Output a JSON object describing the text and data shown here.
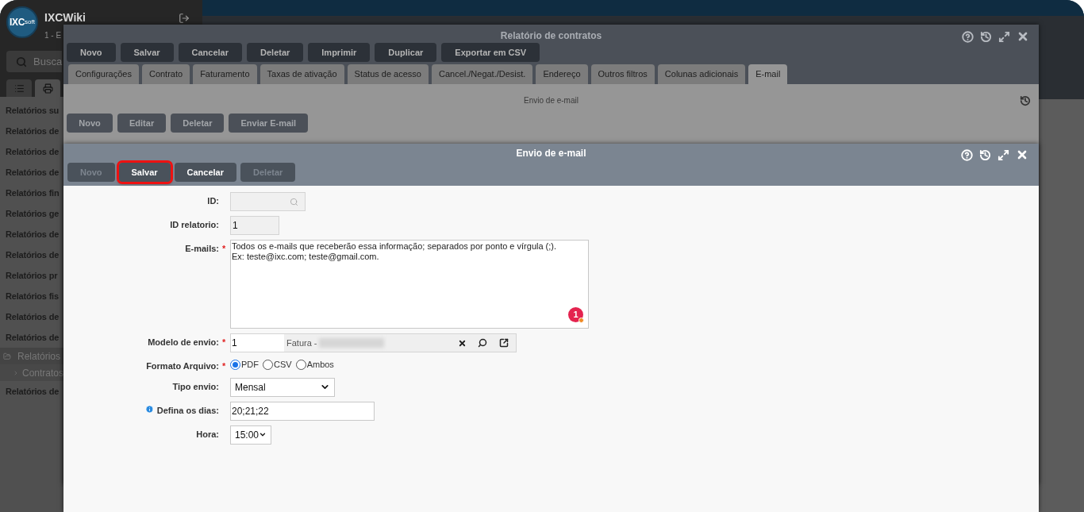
{
  "sidebar": {
    "logo": {
      "main": "IXC",
      "sub": "soft"
    },
    "app_name": "IXCWiki",
    "subtitle": "1 - E",
    "search": {
      "placeholder": "Busca"
    },
    "tabs": [
      {
        "kind": "list",
        "selected": false
      },
      {
        "kind": "print",
        "selected": true
      }
    ],
    "items": [
      {
        "label": "Relatórios su",
        "selected": false
      },
      {
        "label": "Relatórios de",
        "selected": false
      },
      {
        "label": "Relatórios de",
        "selected": false
      },
      {
        "label": "Relatórios de",
        "selected": false
      },
      {
        "label": "Relatórios fin",
        "selected": false
      },
      {
        "label": "Relatórios ge",
        "selected": false
      },
      {
        "label": "Relatórios de",
        "selected": false
      },
      {
        "label": "Relatórios de",
        "selected": false
      },
      {
        "label": "Relatórios pr",
        "selected": false
      },
      {
        "label": "Relatórios fis",
        "selected": false
      },
      {
        "label": "Relatórios de",
        "selected": false
      },
      {
        "label": "Relatórios de",
        "selected": false
      },
      {
        "label": "Relatórios",
        "kind": "folder",
        "expanded": true,
        "selected": false,
        "children": [
          {
            "label": "Contratos",
            "selected": true
          }
        ]
      },
      {
        "label": "Relatórios de",
        "selected": false
      }
    ]
  },
  "back_window": {
    "title": "Relatório de contratos",
    "toolbar": [
      "Novo",
      "Salvar",
      "Cancelar",
      "Deletar",
      "Imprimir",
      "Duplicar",
      "Exportar em CSV"
    ],
    "tabs": [
      {
        "label": "Configurações",
        "selected": false
      },
      {
        "label": "Contrato",
        "selected": false
      },
      {
        "label": "Faturamento",
        "selected": false
      },
      {
        "label": "Taxas de ativação",
        "selected": false
      },
      {
        "label": "Status de acesso",
        "selected": false
      },
      {
        "label": "Cancel./Negat./Desist.",
        "selected": false
      },
      {
        "label": "Endereço",
        "selected": false
      },
      {
        "label": "Outros filtros",
        "selected": false
      },
      {
        "label": "Colunas adicionais",
        "selected": false
      },
      {
        "label": "E-mail",
        "selected": true
      }
    ],
    "section_title": "Envio de e-mail",
    "buttons": [
      "Novo",
      "Editar",
      "Deletar",
      "Enviar E-mail"
    ]
  },
  "front_window": {
    "title": "Envio de e-mail",
    "toolbar": [
      {
        "label": "Novo",
        "disabled": true,
        "highlighted": false
      },
      {
        "label": "Salvar",
        "disabled": false,
        "highlighted": true
      },
      {
        "label": "Cancelar",
        "disabled": false,
        "highlighted": false
      },
      {
        "label": "Deletar",
        "disabled": true,
        "highlighted": false
      }
    ],
    "fields": [
      {
        "kind": "lookup",
        "label": "ID:"
      },
      {
        "kind": "text",
        "label": "ID relatorio:",
        "value": "1"
      },
      {
        "kind": "textarea",
        "label": "E-mails:",
        "required_mark": "*",
        "placeholder": "Todos os e-mails que receberão essa informação; separados por ponto e vírgula (;).\nEx: teste@ixc.com; teste@gmail.com.",
        "badge": "1"
      },
      {
        "kind": "model",
        "label": "Modelo de envio:",
        "required_mark": "*",
        "value": "1",
        "description": "Fatura -"
      },
      {
        "kind": "radio",
        "label": "Formato Arquivo:",
        "required_mark": "*",
        "options": [
          {
            "label": "PDF",
            "selected": true
          },
          {
            "label": "CSV",
            "selected": false
          },
          {
            "label": "Ambos",
            "selected": false
          }
        ]
      },
      {
        "kind": "select",
        "label": "Tipo envio:",
        "value": "Mensal"
      },
      {
        "kind": "days",
        "label": "Defina os dias:",
        "value": "20;21;22"
      },
      {
        "kind": "hour",
        "label": "Hora:",
        "value": "15:00"
      }
    ]
  }
}
